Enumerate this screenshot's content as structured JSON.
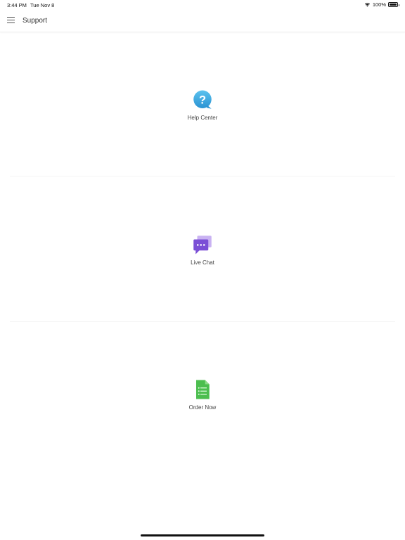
{
  "status_bar": {
    "time": "3:44 PM",
    "date": "Tue Nov 8",
    "battery": "100%"
  },
  "nav": {
    "title": "Support"
  },
  "items": [
    {
      "label": "Help Center",
      "icon": "question-bubble-icon",
      "color": "#3aa6e0"
    },
    {
      "label": "Live Chat",
      "icon": "chat-bubble-icon",
      "color": "#7b4fd6"
    },
    {
      "label": "Order Now",
      "icon": "document-list-icon",
      "color": "#4cbe4f"
    }
  ]
}
